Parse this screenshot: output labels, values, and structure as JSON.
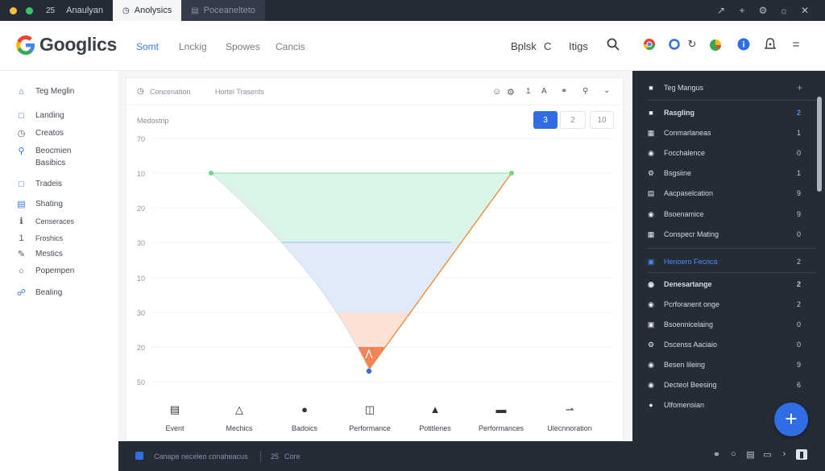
{
  "chrome": {
    "counter": "25",
    "tab1": "Anaulyan",
    "tab2": "Anolysics",
    "tab3": "Poceanelteto"
  },
  "header": {
    "logo_text": "Googlics",
    "nav": [
      "Somt",
      "Lnckig",
      "Spowes",
      "Cancis"
    ],
    "right_label1": "Bplsk",
    "right_label2": "C",
    "right_label3": "Itigs"
  },
  "sidebar": {
    "items": [
      {
        "label": "Teg Meglin",
        "icon": "home-icon"
      },
      {
        "label": "Landing",
        "icon": "square-icon"
      },
      {
        "label": "Creatos",
        "icon": "clock-icon"
      },
      {
        "label": "Beocmien",
        "icon": "search-icon"
      },
      {
        "label": "Basibics",
        "icon": ""
      },
      {
        "label": "Tradeis",
        "icon": "square-icon"
      },
      {
        "label": "Shating",
        "icon": "list-icon"
      },
      {
        "label": "Censeraces",
        "icon": "info-icon"
      },
      {
        "label": "Froshics",
        "icon": "one-icon"
      },
      {
        "label": "Mestics",
        "icon": "pen-icon"
      },
      {
        "label": "Popempen",
        "icon": "circle-icon"
      },
      {
        "label": "Bealing",
        "icon": "bag-icon"
      }
    ]
  },
  "main": {
    "title": "Concenation",
    "subtitle": "Hortel Trasents",
    "chart_label": "Medostrip",
    "segments": [
      "3",
      "2",
      "10"
    ],
    "head_icons": [
      "smile-icon",
      "gear-icon",
      "one-icon",
      "a-icon",
      "link-icon",
      "tag-icon",
      "chevron-down-icon"
    ],
    "bottom_tabs": [
      {
        "label": "Event",
        "icon": "doc-icon"
      },
      {
        "label": "Mechics",
        "icon": "bell-icon"
      },
      {
        "label": "Badoics",
        "icon": "dot-icon"
      },
      {
        "label": "Performance",
        "icon": "bars-icon"
      },
      {
        "label": "Potitlenes",
        "icon": "cube-icon"
      },
      {
        "label": "Performances",
        "icon": "battery-icon"
      },
      {
        "label": "Ulecnnoration",
        "icon": "arrow-icon"
      }
    ]
  },
  "chart_data": {
    "type": "area",
    "ylabel": "Medostrip",
    "y_ticks": [
      "70",
      "10",
      "20",
      "30",
      "10",
      "30",
      "20",
      "50"
    ],
    "points": [
      {
        "label": "start",
        "y": 10
      },
      {
        "label": "end",
        "y": 10
      },
      {
        "label": "bottom",
        "y": 50
      }
    ],
    "bands": [
      {
        "name": "green",
        "color": "#d8f3e6"
      },
      {
        "name": "blue",
        "color": "#dde9f8"
      },
      {
        "name": "orange",
        "color": "#fbdccf"
      }
    ],
    "colors": {
      "left_line": "#d6d9de",
      "right_line": "#e8903e",
      "marker_top": "#6ad97d",
      "marker_bottom": "#2f6ee5"
    }
  },
  "rpanel": {
    "title": "Teg Mangus",
    "rows": [
      {
        "label": "Rasgling",
        "value": "2",
        "bold": true
      },
      {
        "label": "Conmarlaneas",
        "value": "1"
      },
      {
        "label": "Focchalence",
        "value": "0"
      },
      {
        "label": "Bsgsiine",
        "value": "1"
      },
      {
        "label": "Aacpaselcation",
        "value": "9"
      },
      {
        "label": "Bsoenamice",
        "value": "9"
      },
      {
        "label": "Conspecr Mating",
        "value": "0"
      },
      {
        "label": "Henoero Fecrica",
        "value": "2",
        "highlight": true
      },
      {
        "label": "Denesartange",
        "value": "2",
        "bold": true
      },
      {
        "label": "Pcrforanent onge",
        "value": "2"
      },
      {
        "label": "Bsoennicelaing",
        "value": "0"
      },
      {
        "label": "Dscenss Aaciaio",
        "value": "0"
      },
      {
        "label": "Besen lileing",
        "value": "9"
      },
      {
        "label": "Decteol Beesing",
        "value": "6"
      },
      {
        "label": "Ulfomensian",
        "value": ""
      }
    ]
  },
  "statusbar": {
    "text1": "Canape neceleo conaheacus",
    "num": "25",
    "text2": "Core"
  }
}
